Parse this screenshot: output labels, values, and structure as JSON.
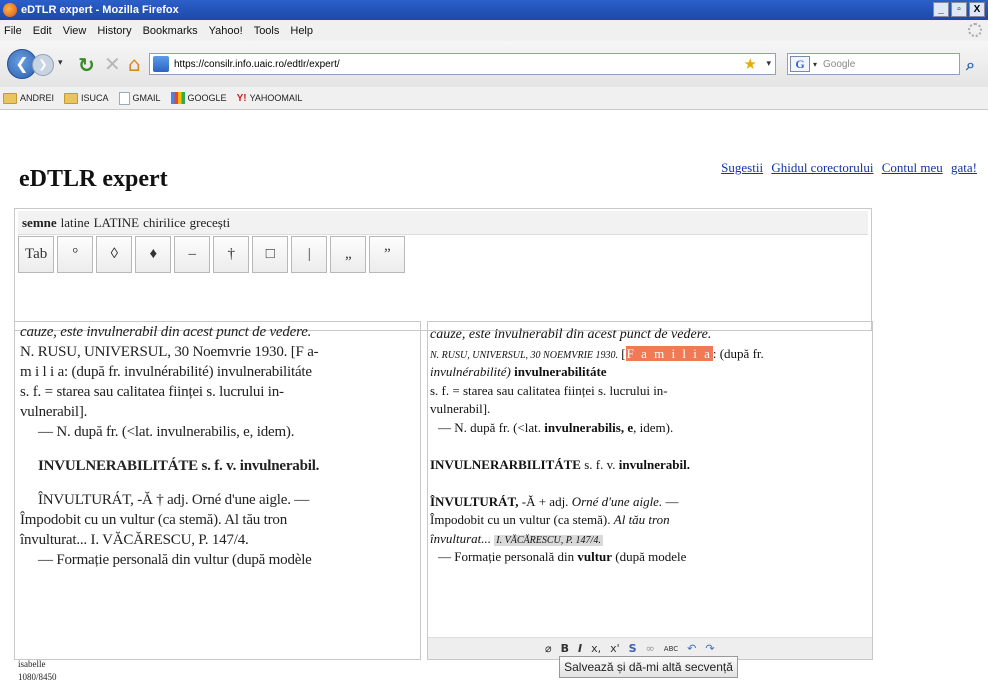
{
  "window": {
    "title": "eDTLR expert - Mozilla Firefox",
    "controls": [
      "_",
      "▫",
      "X"
    ]
  },
  "menu": [
    "File",
    "Edit",
    "View",
    "History",
    "Bookmarks",
    "Yahoo!",
    "Tools",
    "Help"
  ],
  "nav": {
    "url": "https://consilr.info.uaic.ro/edtlr/expert/",
    "search_placeholder": "Google"
  },
  "bookmarks": [
    "ANDREI",
    "ISUCA",
    "GMAIL",
    "GOOGLE",
    "YAHOOMAIL"
  ],
  "app": {
    "title": "eDTLR expert"
  },
  "links": [
    "Sugestii",
    "Ghidul corectorului",
    "Contul meu",
    "gata!"
  ],
  "tabs": [
    "semne",
    "latine",
    "LATINE",
    "chirilice",
    "grecești"
  ],
  "symbols": [
    "Tab",
    "°",
    "◊",
    "♦",
    "–",
    "†",
    "□",
    "|",
    "„",
    "”"
  ],
  "scan_lines": [
    "cauze, este invulnerabil din acest punct de vedere.",
    "N. RUSU, UNIVERSUL, 30 Noemvrie 1930. [F a-",
    "m i l i a: (după fr. invulnérabilité) invulnerabilitáte",
    "s. f. = starea sau calitatea ființei s. lucrului in-",
    "vulnerabil].",
    "— N. după fr. (<lat. invulnerabilis, e, idem).",
    "",
    "INVULNERABILITÁTE s. f. v. invulnerabil.",
    "",
    "ÎNVULTURÁT, -Ă † adj. Orné d'une aigle. —",
    "Împodobit cu un vultur (ca stemă). Al tău tron",
    "învulturat... I. VĂCĂRESCU, P. 147/4.",
    "— Formație personală din vultur (după modèle"
  ],
  "editor": {
    "l1": "cauze, este invulnerabil din acest punct de vedere.",
    "l2_src": "N. RUSU, UNIVERSUL, 30 NOEMVRIE 1930.",
    "l2_bracket": "[",
    "l2_hl": "F a m i l i a",
    "l2_rest": ": (după fr.",
    "l3_it": "invulnérabilité)",
    "l3_b": "invulnerabilitáte",
    "l4": "s. f. = starea sau calitatea ființei s. lucrului in-",
    "l5": "vulnerabil].",
    "l6_a": "— N. după fr. (<lat.",
    "l6_b": "invulnerabilis, e",
    "l6_c": ", idem).",
    "l7_b": "INVULNERARBILITÁTE",
    "l7_a": "s. f. v.",
    "l7_c": "invulnerabil.",
    "l8_b": "ÎNVULTURÁT,",
    "l8_a": "-Ă + adj.",
    "l8_it": "Orné d'une aigle.",
    "l8_c": "—",
    "l9_a": "Împodobit cu un vultur (ca stemă).",
    "l9_it": "Al tău tron",
    "l10_it": "învulturat...",
    "l10_src": "I. VĂCĂRESCU, P. 147/4.",
    "l11_a": "— Formație personală din",
    "l11_b": "vultur",
    "l11_c": "(după modele"
  },
  "editor_toolbar": [
    "eraser-icon",
    "B",
    "I",
    "x,",
    "x'",
    "S",
    "link-icon",
    "abc-icon",
    "undo-icon",
    "redo-icon"
  ],
  "editor_toolbar_glyphs": {
    "eraser": "⌀",
    "bold": "B",
    "italic": "I",
    "sub": "x,",
    "sup": "x'",
    "strike": "S",
    "link": "∞",
    "abc": "ABC",
    "undo": "↶",
    "redo": "↷"
  },
  "status": {
    "user": "isabelle",
    "progress": "1080/8450"
  },
  "save_button": "Salvează și dă-mi altă secvență"
}
